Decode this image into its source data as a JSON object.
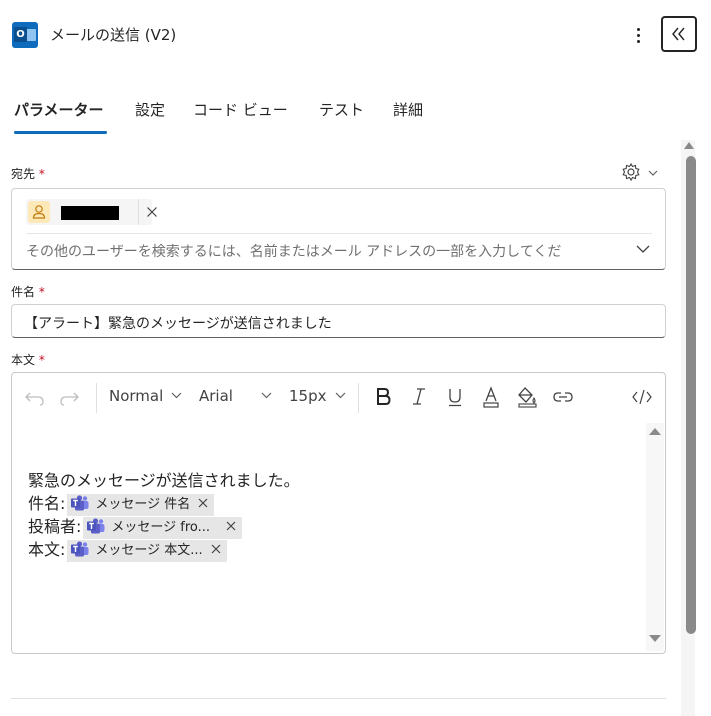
{
  "header": {
    "title": "メールの送信 (V2)",
    "app_icon_letter": "O",
    "more_icon": "more-vertical-icon",
    "collapse_icon": "double-chevron-left-icon"
  },
  "tabs": [
    {
      "label": "パラメーター",
      "active": true
    },
    {
      "label": "設定",
      "active": false
    },
    {
      "label": "コード ビュー",
      "active": false
    },
    {
      "label": "テスト",
      "active": false
    },
    {
      "label": "詳細",
      "active": false
    }
  ],
  "to": {
    "label": "宛先",
    "required_mark": "*",
    "placeholder": "その他のユーザーを検索するには、名前またはメール アドレスの一部を入力してくだ"
  },
  "subject": {
    "label": "件名",
    "required_mark": "*",
    "value": "【アラート】緊急のメッセージが送信されました"
  },
  "body": {
    "label": "本文",
    "required_mark": "*",
    "toolbar": {
      "style": "Normal",
      "font": "Arial",
      "size": "15px"
    },
    "intro": "緊急のメッセージが送信されました。",
    "lines": [
      {
        "prefix": "件名:",
        "token": "メッセージ 件名"
      },
      {
        "prefix": "投稿者:",
        "token": "メッセージ fro..."
      },
      {
        "prefix": "本文:",
        "token": "メッセージ 本文..."
      }
    ]
  },
  "colors": {
    "accent": "#0f6cbd",
    "required": "#c50f1f",
    "token_bg": "#e6e6e6",
    "teams": "#5b5fc7"
  }
}
